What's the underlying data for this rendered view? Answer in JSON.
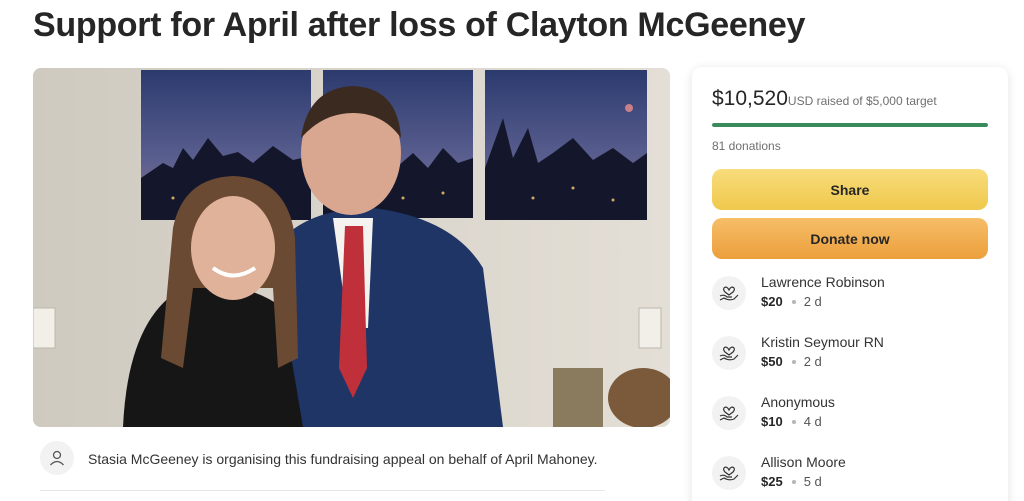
{
  "page": {
    "title": "Support for April after loss of Clayton McGeeney"
  },
  "photo": {
    "description_icon": "couple-photo"
  },
  "organiser": {
    "icon": "user-icon",
    "text": "Stasia McGeeney is organising this fundraising appeal on behalf of April Mahoney."
  },
  "donation_card": {
    "amount": "$10,520",
    "amount_suffix": "USD raised of $5,000 target",
    "progress_fraction": 1.0,
    "donation_count": "81 donations",
    "share_label": "Share",
    "donate_label": "Donate now",
    "colors": {
      "progress": "#3a8b5a",
      "share": "#efc94c",
      "donate": "#ec9f3c"
    }
  },
  "donations": [
    {
      "name": "Lawrence Robinson",
      "amount": "$20",
      "time": "2 d",
      "icon": "hand-heart-icon"
    },
    {
      "name": "Kristin Seymour RN",
      "amount": "$50",
      "time": "2 d",
      "icon": "hand-heart-icon"
    },
    {
      "name": "Anonymous",
      "amount": "$10",
      "time": "4 d",
      "icon": "hand-heart-icon"
    },
    {
      "name": "Allison Moore",
      "amount": "$25",
      "time": "5 d",
      "icon": "hand-heart-icon"
    }
  ]
}
